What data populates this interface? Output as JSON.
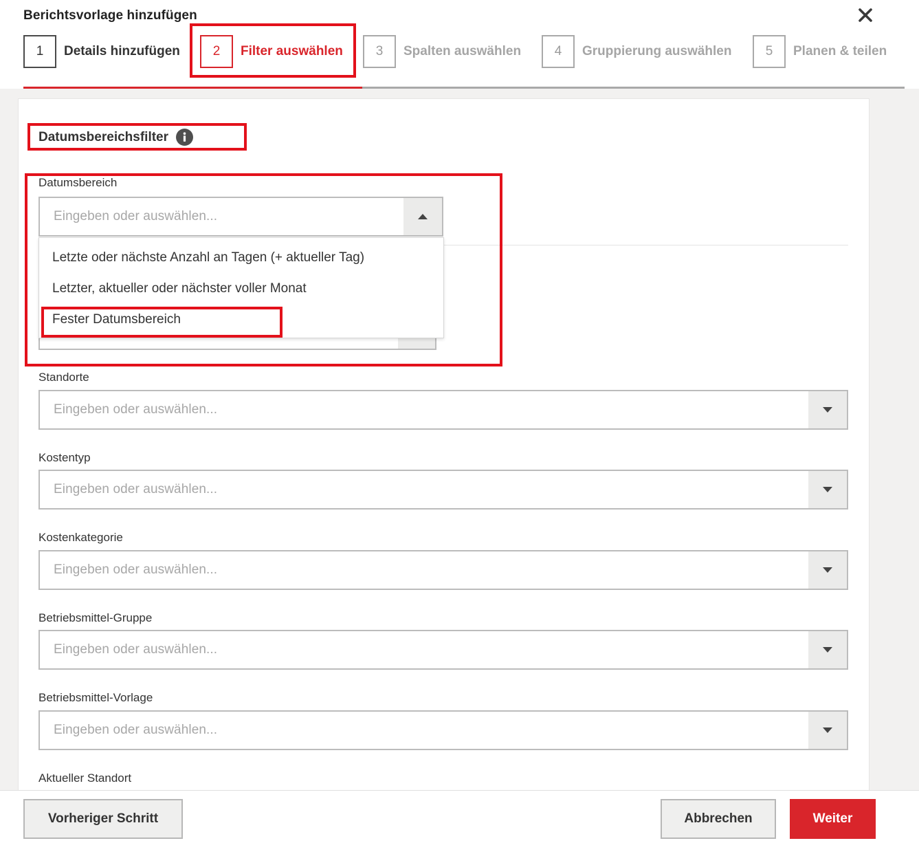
{
  "dialog": {
    "title": "Berichtsvorlage hinzufügen",
    "close_icon": "close-icon"
  },
  "steps": [
    {
      "number": "1",
      "label": "Details hinzufügen",
      "state": "done"
    },
    {
      "number": "2",
      "label": "Filter auswählen",
      "state": "active"
    },
    {
      "number": "3",
      "label": "Spalten auswählen",
      "state": "upcoming"
    },
    {
      "number": "4",
      "label": "Gruppierung auswählen",
      "state": "upcoming"
    },
    {
      "number": "5",
      "label": "Planen & teilen",
      "state": "upcoming"
    }
  ],
  "section": {
    "title": "Datumsbereichsfilter",
    "info_icon": "info-icon"
  },
  "date_range": {
    "label": "Datumsbereich",
    "placeholder": "Eingeben oder auswählen...",
    "expanded": true,
    "options": [
      "Letzte oder nächste Anzahl an Tagen (+ aktueller Tag)",
      "Letzter, aktueller oder nächster voller Monat",
      "Fester Datumsbereich"
    ]
  },
  "filters": [
    {
      "label": "Standorte",
      "placeholder": "Eingeben oder auswählen..."
    },
    {
      "label": "Kostentyp",
      "placeholder": "Eingeben oder auswählen..."
    },
    {
      "label": "Kostenkategorie",
      "placeholder": "Eingeben oder auswählen..."
    },
    {
      "label": "Betriebsmittel-Gruppe",
      "placeholder": "Eingeben oder auswählen..."
    },
    {
      "label": "Betriebsmittel-Vorlage",
      "placeholder": "Eingeben oder auswählen..."
    },
    {
      "label": "Aktueller Standort"
    }
  ],
  "footer": {
    "back": "Vorheriger Schritt",
    "cancel": "Abbrechen",
    "next": "Weiter"
  },
  "colors": {
    "accent": "#d9252b",
    "annotation": "#e3111b",
    "panel_bg": "#f2f1f0"
  }
}
